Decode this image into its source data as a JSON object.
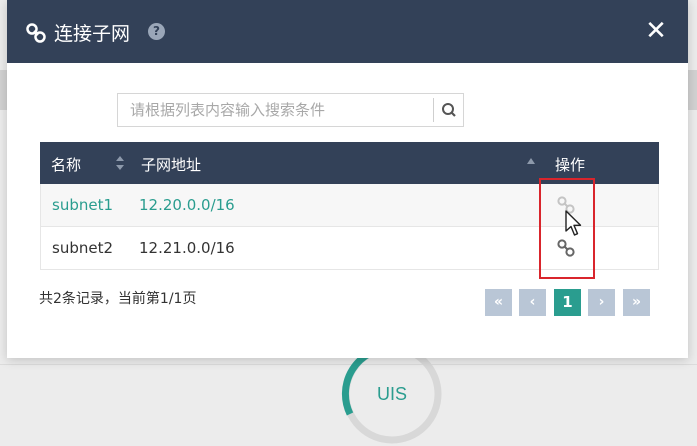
{
  "dialog": {
    "title": "连接子网",
    "help_glyph": "?",
    "close_glyph": "✕"
  },
  "search": {
    "placeholder": "请根据列表内容输入搜索条件"
  },
  "table": {
    "columns": [
      "名称",
      "子网地址",
      "操作"
    ],
    "rows": [
      {
        "name": "subnet1",
        "address": "12.20.0.0/16",
        "action": "link-icon"
      },
      {
        "name": "subnet2",
        "address": "12.21.0.0/16",
        "action": "link-icon"
      }
    ]
  },
  "footer": {
    "summary": "共2条记录，当前第1/1页"
  },
  "pagination": {
    "first": "«",
    "prev": "‹",
    "current": "1",
    "next": "›",
    "last": "»"
  },
  "background": {
    "ring_label": "UIS"
  },
  "colors": {
    "header_bg": "#334158",
    "accent": "#2a9d8f",
    "highlight": "#d9252c",
    "pager_bg": "#b9c6d6"
  }
}
